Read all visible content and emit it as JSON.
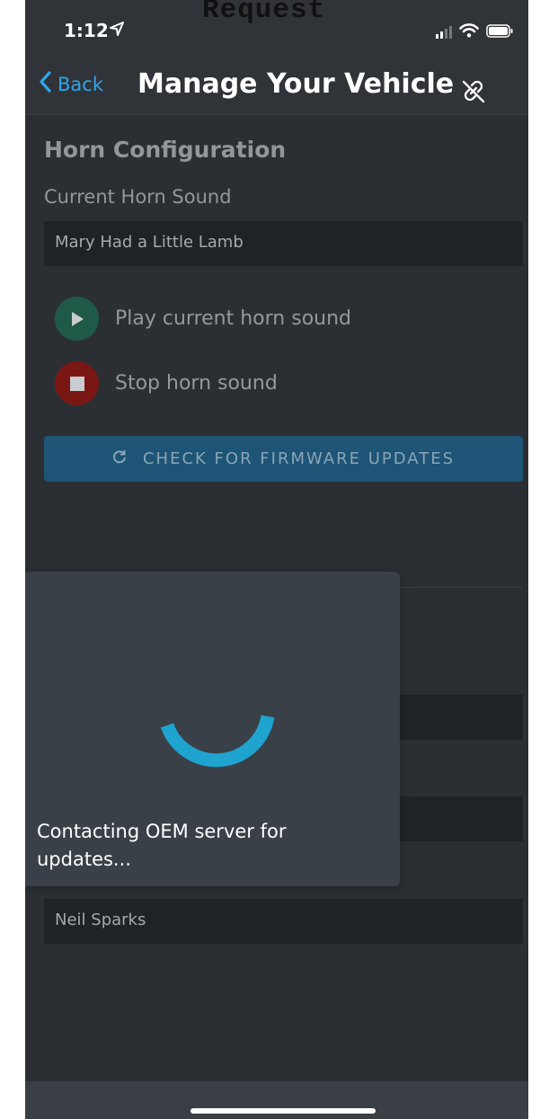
{
  "overlay": {
    "title": "Request"
  },
  "status_bar": {
    "time": "1:12"
  },
  "nav": {
    "back_label": "Back",
    "title": "Manage Your Vehicle"
  },
  "horn": {
    "section_title": "Horn Configuration",
    "current_label": "Current Horn Sound",
    "current_value": "Mary Had a Little Lamb",
    "play_label": "Play current horn sound",
    "stop_label": "Stop horn sound"
  },
  "firmware": {
    "button_label": "CHECK FOR FIRMWARE UPDATES"
  },
  "owner": {
    "value": "Neil Sparks"
  },
  "modal": {
    "message": "Contacting OEM server for updates..."
  },
  "colors": {
    "accent_blue": "#2ea6ea",
    "play_green": "#1f5a48",
    "stop_red": "#7a1714",
    "spinner": "#1fa3cf",
    "firmware_button": "#1e5475"
  },
  "icons": {
    "location": "location-arrow-icon",
    "signal": "signal-icon",
    "wifi": "wifi-icon",
    "battery": "battery-icon",
    "back": "chevron-left-icon",
    "unlink": "unlink-icon",
    "play": "play-icon",
    "stop": "stop-icon",
    "refresh": "refresh-icon"
  }
}
